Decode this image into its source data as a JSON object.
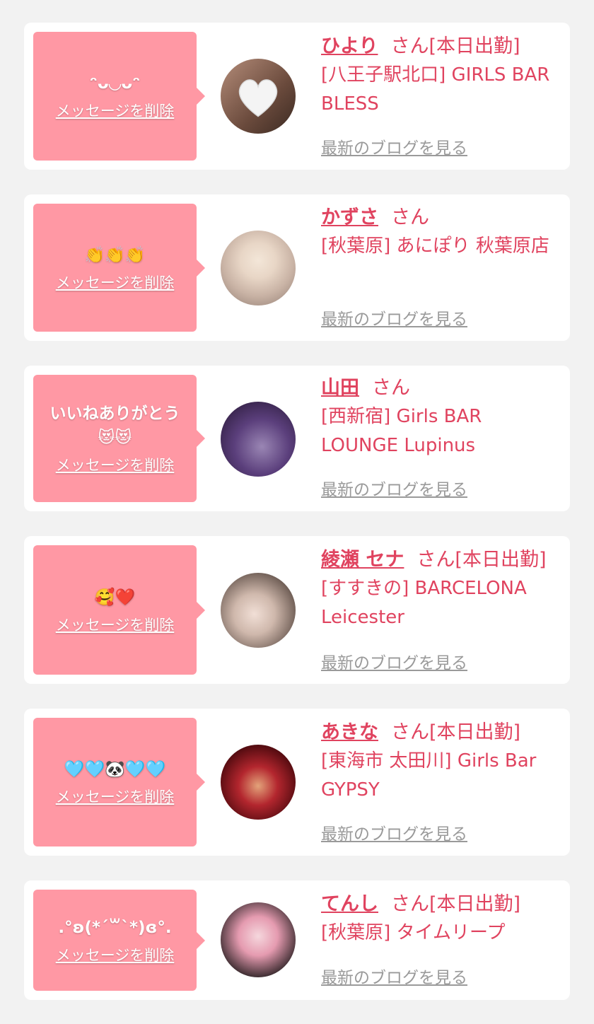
{
  "delete_label": "メッセージを削除",
  "blog_label": "最新のブログを見る",
  "colors": {
    "bubble": "#ff98a4",
    "accent": "#e0435f",
    "link_gray": "#9a9a9a"
  },
  "cards": [
    {
      "message": "ᵔᴗ◡ᴗᵔ",
      "name": "ひより",
      "suffix": "さん[本日出勤]",
      "shop": "[八王子駅北口] GIRLS BAR BLESS",
      "avatar_icon": "white-heart-icon"
    },
    {
      "message": "👏👏👏",
      "name": "かずさ",
      "suffix": "さん",
      "shop": "[秋葉原] あにぽり 秋葉原店",
      "avatar_icon": "user-photo"
    },
    {
      "message": "いいねありがとう\n😻😻",
      "name": "山田",
      "suffix": "さん",
      "shop": "[西新宿] Girls BAR LOUNGE Lupinus",
      "avatar_icon": "user-photo"
    },
    {
      "message": "🥰❤️",
      "name": "綾瀬 セナ",
      "suffix": "さん[本日出勤]",
      "shop": "[すすきの] BARCELONA Leicester",
      "avatar_icon": "user-photo"
    },
    {
      "message": "🩵🩵🐼🩵🩵",
      "name": "あきな",
      "suffix": "さん[本日出勤]",
      "shop": "[東海市 太田川] Girls Bar GYPSY",
      "avatar_icon": "user-photo"
    },
    {
      "message": ".°ʚ(*´꒳`*)ɞ°.",
      "name": "てんし",
      "suffix": "さん[本日出勤]",
      "shop": "[秋葉原] タイムリープ",
      "avatar_icon": "user-photo"
    }
  ]
}
